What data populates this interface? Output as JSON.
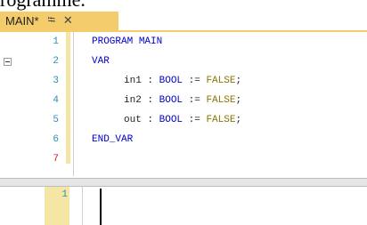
{
  "caption": "rogramme.",
  "tab": {
    "title": "MAIN*",
    "pin_icon": "pin-icon",
    "close_icon": "close-icon"
  },
  "editor": {
    "line_numbers": [
      "1",
      "2",
      "3",
      "4",
      "5",
      "6",
      "7"
    ],
    "line1": {
      "kw1": "PROGRAM",
      "name": " MAIN"
    },
    "line2": {
      "kw": "VAR"
    },
    "line3": {
      "ident": "in1",
      "sep": " : ",
      "type": "BOOL",
      "assign": " := ",
      "val": "FALSE",
      "end": ";"
    },
    "line4": {
      "ident": "in2",
      "sep": " : ",
      "type": "BOOL",
      "assign": " := ",
      "val": "FALSE",
      "end": ";"
    },
    "line5": {
      "ident": "out",
      "sep": " : ",
      "type": "BOOL",
      "assign": " := ",
      "val": "FALSE",
      "end": ";"
    },
    "line6": {
      "kw": "END_VAR"
    }
  },
  "bottom_pane": {
    "line_numbers": [
      "1"
    ]
  },
  "colors": {
    "tab_active": "#f5cc6b",
    "keyword": "#0000cc",
    "literal": "#8a7400",
    "line_number": "#2b91af",
    "error_line_number": "#d11e1e"
  }
}
